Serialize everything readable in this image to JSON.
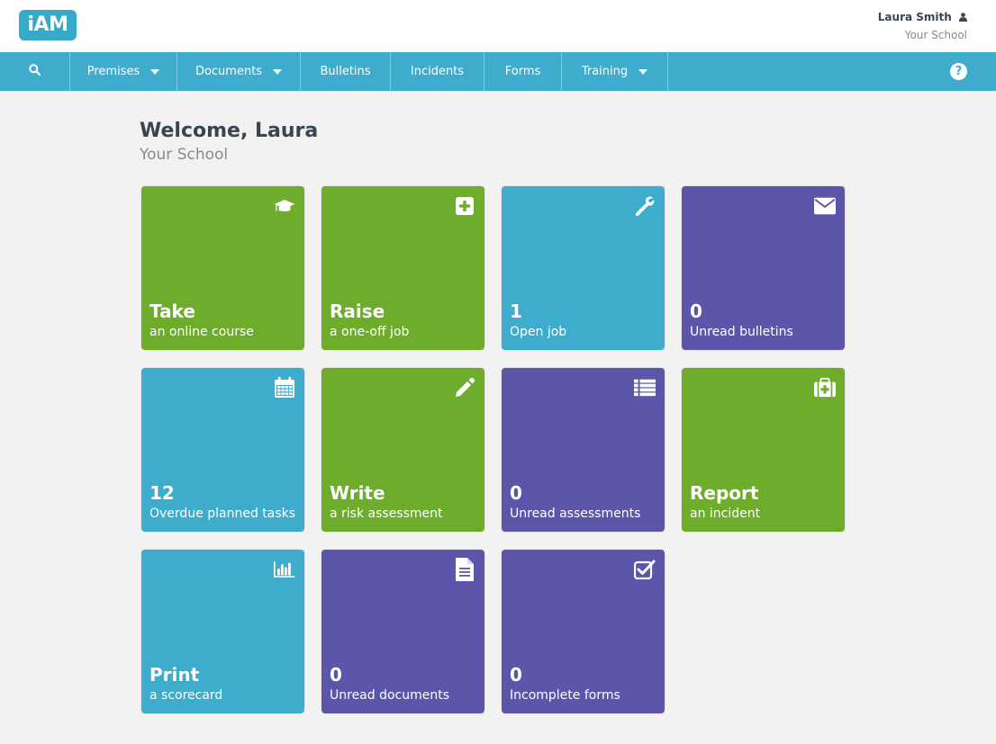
{
  "header": {
    "logo_text": "iAM",
    "user_name": "Laura Smith",
    "user_school": "Your School"
  },
  "nav": {
    "items": [
      {
        "label": "Premises",
        "dropdown": true
      },
      {
        "label": "Documents",
        "dropdown": true
      },
      {
        "label": "Bulletins",
        "dropdown": false
      },
      {
        "label": "Incidents",
        "dropdown": false
      },
      {
        "label": "Forms",
        "dropdown": false
      },
      {
        "label": "Training",
        "dropdown": true
      }
    ],
    "help_label": "?"
  },
  "welcome": {
    "title": "Welcome, Laura",
    "subtitle": "Your School"
  },
  "tiles": [
    {
      "big": "Take",
      "sub": "an online course",
      "icon": "graduation-cap-icon",
      "color": "#6ead2c"
    },
    {
      "big": "Raise",
      "sub": "a one-off job",
      "icon": "plus-square-icon",
      "color": "#6ead2c"
    },
    {
      "big": "1",
      "sub": "Open job",
      "icon": "wrench-icon",
      "color": "#3eaccc"
    },
    {
      "big": "0",
      "sub": "Unread bulletins",
      "icon": "envelope-icon",
      "color": "#5c56ab"
    },
    {
      "big": "12",
      "sub": "Overdue planned tasks",
      "icon": "calendar-icon",
      "color": "#3eaccc"
    },
    {
      "big": "Write",
      "sub": "a risk assessment",
      "icon": "pencil-icon",
      "color": "#6ead2c"
    },
    {
      "big": "0",
      "sub": "Unread assessments",
      "icon": "list-icon",
      "color": "#5c56ab"
    },
    {
      "big": "Report",
      "sub": "an incident",
      "icon": "medkit-icon",
      "color": "#6ead2c"
    },
    {
      "big": "Print",
      "sub": "a scorecard",
      "icon": "bar-chart-icon",
      "color": "#3eaccc"
    },
    {
      "big": "0",
      "sub": "Unread documents",
      "icon": "document-icon",
      "color": "#5c56ab"
    },
    {
      "big": "0",
      "sub": "Incomplete forms",
      "icon": "checkbox-icon",
      "color": "#5c56ab"
    }
  ]
}
